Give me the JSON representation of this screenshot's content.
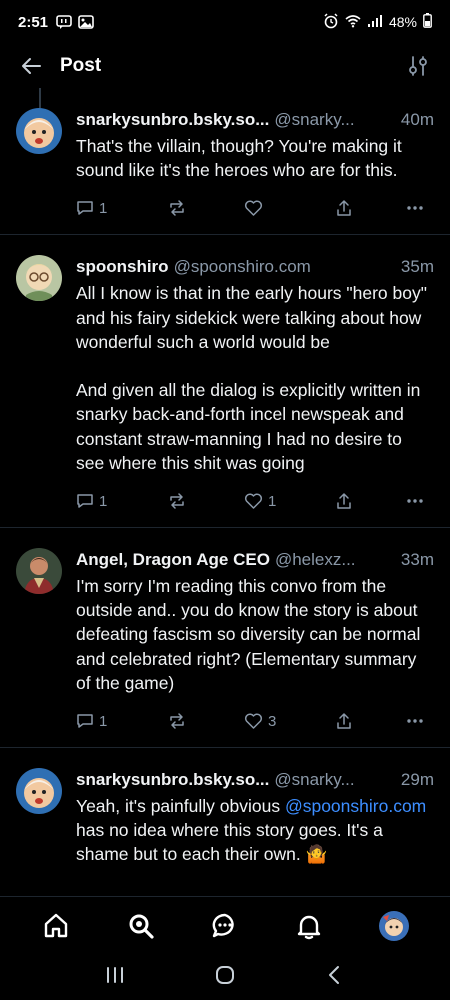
{
  "status_bar": {
    "time": "2:51",
    "battery": "48%",
    "icons": [
      "chat-notification-icon",
      "gallery-notification-icon",
      "alarm-icon",
      "wifi-icon",
      "signal-icon",
      "battery-icon"
    ]
  },
  "header": {
    "title": "Post",
    "back_icon": "arrow-left-icon",
    "filter_icon": "sliders-icon"
  },
  "posts": [
    {
      "display_name": "snarkysunbro.bsky.so...",
      "handle": "@snarky...",
      "age": "40m",
      "text": "That's the villain, though? You're making it sound like it's the heroes who are for this.",
      "reply_count": "1",
      "like_count": ""
    },
    {
      "display_name": "spoonshiro",
      "handle": "@spoonshiro.com",
      "age": "35m",
      "text": "All I know is that in the early hours \"hero boy\" and his fairy sidekick were talking about how wonderful such a world would be\n\nAnd given all the dialog is explicitly written in snarky back-and-forth incel newspeak and constant straw-manning I had no desire to see where this shit was going",
      "reply_count": "1",
      "like_count": "1"
    },
    {
      "display_name": "Angel, Dragon Age CEO",
      "handle": "@helexz...",
      "age": "33m",
      "text": "I'm sorry I'm reading this convo from the outside and.. you do know the story is about defeating fascism so diversity can be normal and celebrated right? (Elementary summary of the game)",
      "reply_count": "1",
      "like_count": "3"
    },
    {
      "display_name": "snarkysunbro.bsky.so...",
      "handle": "@snarky...",
      "age": "29m",
      "text_before": "Yeah, it's painfully obvious ",
      "mention": "@spoonshiro.com",
      "text_after": " has no idea where this story goes. It's a shame but to each their own. 🤷"
    }
  ],
  "bottom_nav": {
    "items": [
      "home-icon",
      "search-icon",
      "chat-icon",
      "notifications-icon",
      "profile-avatar"
    ]
  },
  "system_nav": [
    "recents-icon",
    "home-button-icon",
    "back-icon"
  ],
  "colors": {
    "background": "#000000",
    "text": "#f1f3f5",
    "muted": "#8a98a8",
    "link": "#3d8eff",
    "divider": "#1d252e"
  }
}
